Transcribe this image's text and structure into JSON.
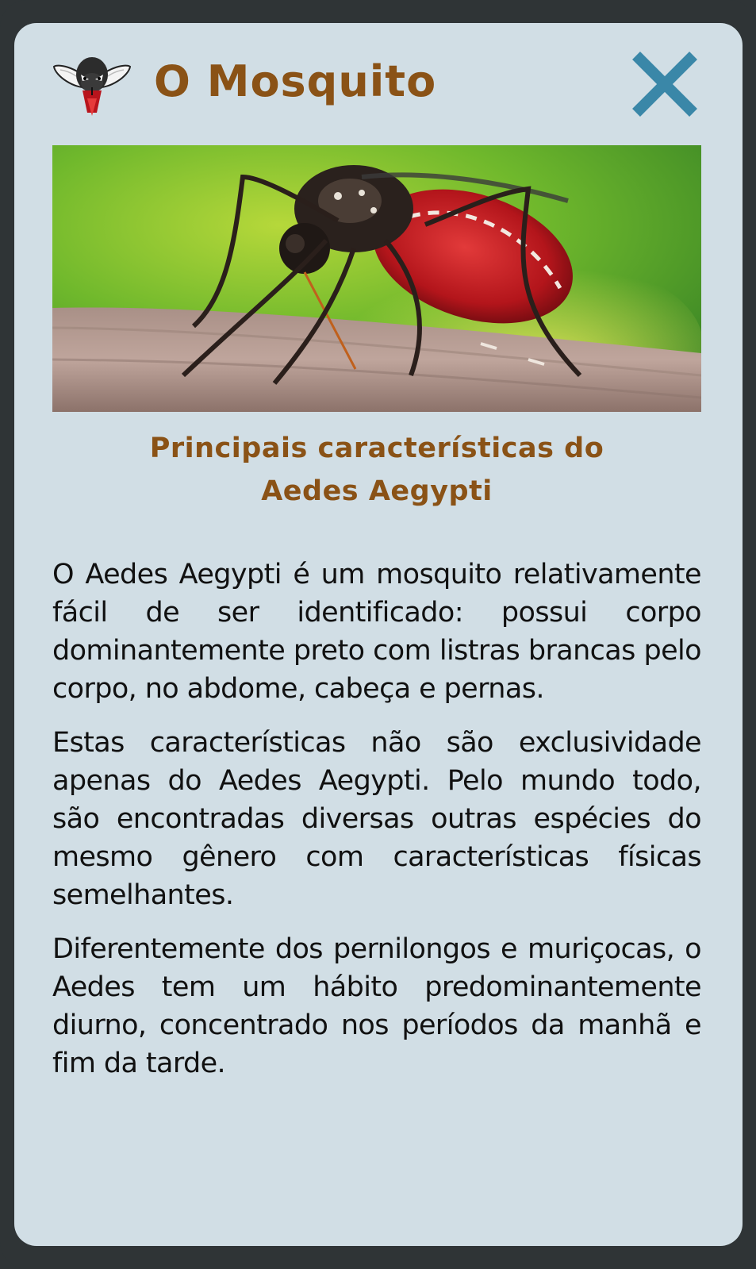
{
  "header": {
    "title": "O Mosquito",
    "logo_icon": "mosquito-mascot-icon",
    "close_icon": "close-icon"
  },
  "hero": {
    "image": "aedes-aegypti-photo"
  },
  "subtitle": {
    "line1": "Principais características do",
    "line2": "Aedes Aegypti"
  },
  "paragraphs": [
    "O Aedes Aegypti é um mosquito relativamente fácil de ser identificado: possui corpo dominantemente preto com listras brancas pelo corpo, no abdome, cabeça e pernas.",
    "Estas características não são exclusividade apenas do Aedes Aegypti. Pelo mundo todo, são encontradas diversas outras espécies do mesmo gênero com características físicas semelhantes.",
    "Diferentemente dos pernilongos e muriçocas, o Aedes tem um hábito predominantemente diurno, concentrado nos períodos da manhã e fim da tarde."
  ],
  "colors": {
    "frame": "#2f3436",
    "card": "#d1dee5",
    "title": "#8a5216",
    "close": "#3a87a8",
    "text": "#111111"
  }
}
